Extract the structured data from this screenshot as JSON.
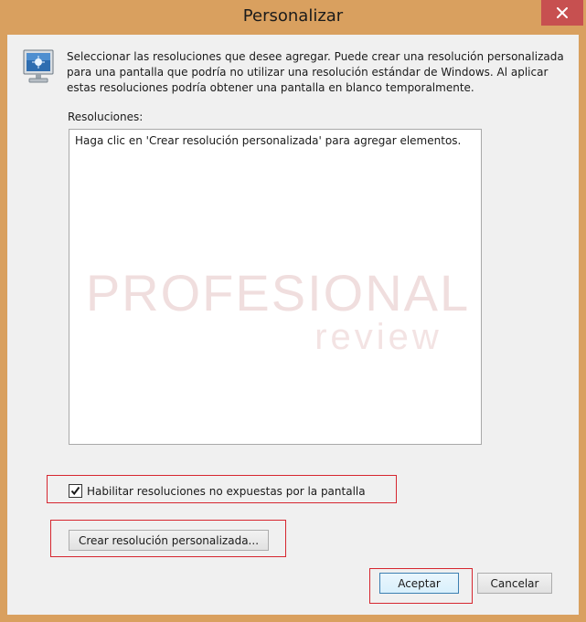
{
  "window": {
    "title": "Personalizar"
  },
  "description": {
    "lines": [
      "Seleccionar las resoluciones que desee agregar. Puede crear una resolución personalizada",
      "para una pantalla que podría no utilizar una resolución estándar de Windows. Al aplicar",
      "estas resoluciones podría obtener una pantalla en blanco temporalmente."
    ]
  },
  "resolutions": {
    "label": "Resoluciones:",
    "empty_hint": "Haga clic en 'Crear resolución personalizada' para agregar elementos."
  },
  "watermark": {
    "top": "PROFESIONAL",
    "bottom": "review"
  },
  "options": {
    "enable_unexposed": {
      "label": "Habilitar resoluciones no expuestas por la pantalla",
      "checked": true
    }
  },
  "buttons": {
    "create_custom": "Crear resolución personalizada...",
    "accept": "Aceptar",
    "cancel": "Cancelar"
  },
  "colors": {
    "frame": "#d9a05f",
    "close_button": "#c75050",
    "highlight": "#d6262f",
    "dialog_bg": "#f0f0f0"
  },
  "icons": {
    "app": "monitor-icon",
    "close": "close-icon",
    "check": "checkmark-icon"
  }
}
